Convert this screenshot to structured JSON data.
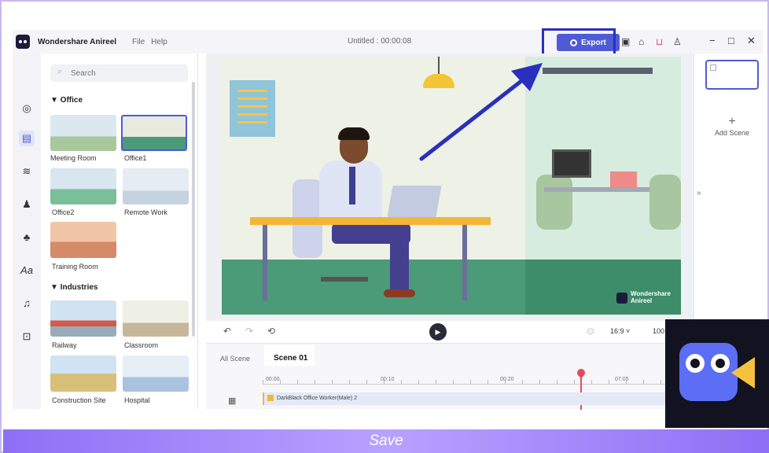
{
  "window": {
    "app_name": "Wondershare Anireel",
    "menu": [
      "File",
      "Help"
    ],
    "doc_title": "Untitled : 00:00:08",
    "export_label": "Export"
  },
  "library": {
    "search_placeholder": "Search",
    "sections": [
      {
        "title": "▼ Office",
        "items": [
          "Meeting Room",
          "Office1",
          "Office2",
          "Remote Work",
          "Training Room"
        ]
      },
      {
        "title": "▼ Industries",
        "items": [
          "Railway",
          "Classroom",
          "Construction Site",
          "Hospital"
        ]
      }
    ]
  },
  "canvas": {
    "watermark_line1": "Wondershare",
    "watermark_line2": "Anireel"
  },
  "playbar": {
    "aspect_ratio": "16:9 ˅",
    "zoom": "100"
  },
  "timeline": {
    "tabs": [
      "All Scene",
      "Scene 01"
    ],
    "ticks": [
      "00:00",
      "00:10",
      "00:20",
      "07:05"
    ],
    "track_label": "DarkBlack Office Worker(Male) 2"
  },
  "scenes": {
    "add_label": "Add Scene"
  },
  "caption": {
    "text": "Save"
  },
  "colors": {
    "accent": "#4f5bd5",
    "highlight": "#2a2fc0",
    "caption": "#9b80f8",
    "playhead": "#e24b5b"
  }
}
